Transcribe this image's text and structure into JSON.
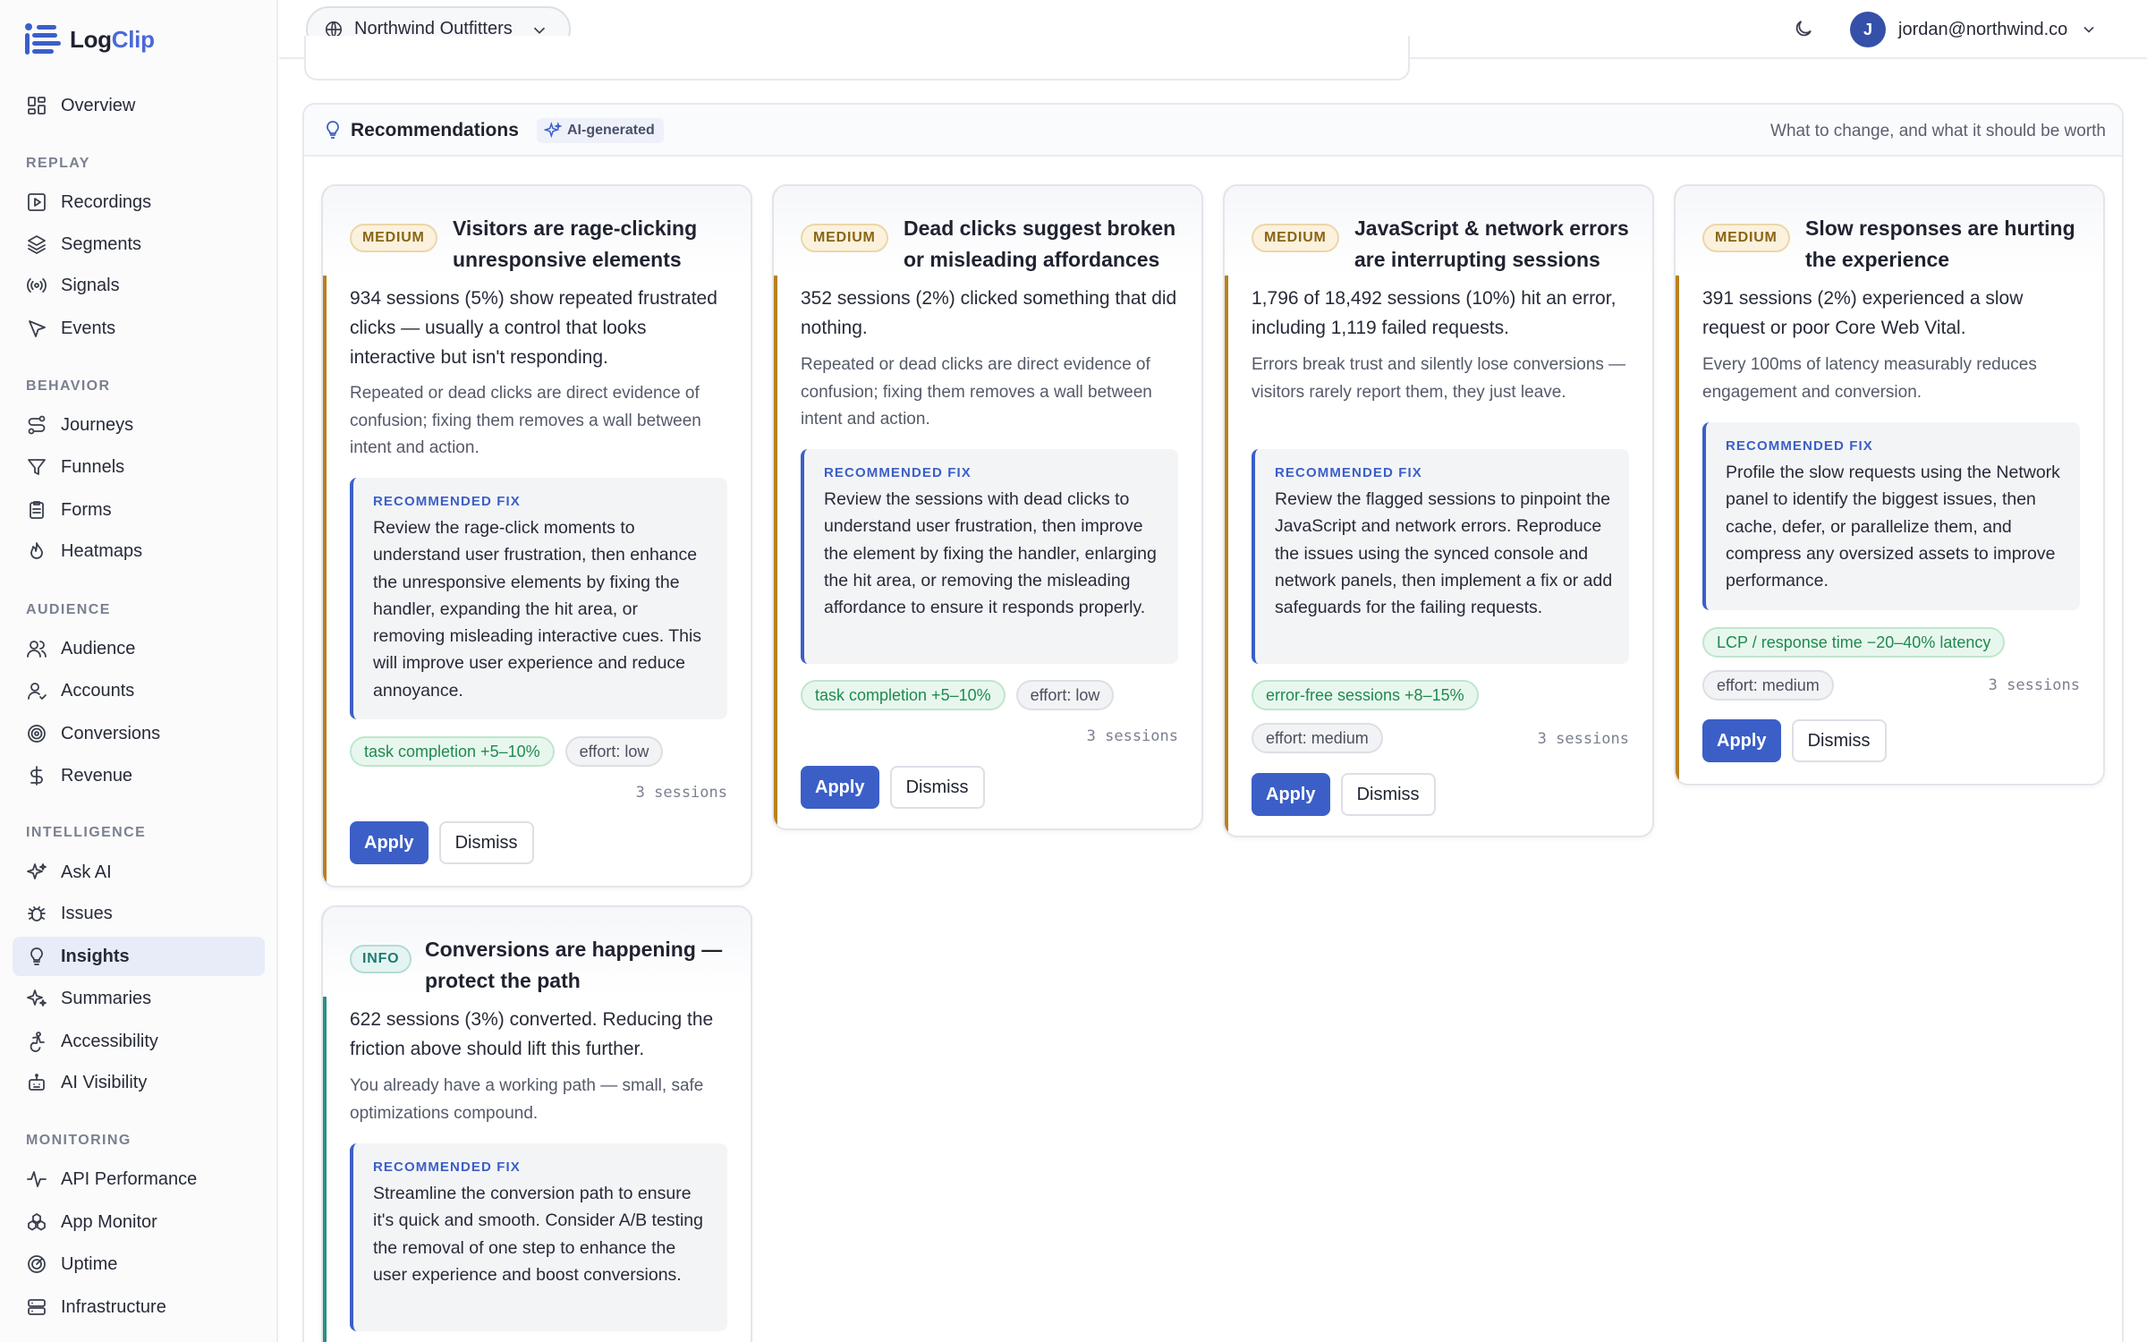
{
  "app": {
    "name_part1": "Log",
    "name_part2": "Clip"
  },
  "topbar": {
    "org_name": "Northwind Outfitters",
    "user_email": "jordan@northwind.co",
    "user_initial": "J"
  },
  "sidebar": {
    "overview": "Overview",
    "sections": {
      "replay": "REPLAY",
      "behavior": "BEHAVIOR",
      "audience": "AUDIENCE",
      "intelligence": "INTELLIGENCE",
      "monitoring": "MONITORING"
    },
    "items": {
      "recordings": "Recordings",
      "segments": "Segments",
      "signals": "Signals",
      "events": "Events",
      "journeys": "Journeys",
      "funnels": "Funnels",
      "forms": "Forms",
      "heatmaps": "Heatmaps",
      "audience": "Audience",
      "accounts": "Accounts",
      "conversions": "Conversions",
      "revenue": "Revenue",
      "ask_ai": "Ask AI",
      "issues": "Issues",
      "insights": "Insights",
      "summaries": "Summaries",
      "accessibility": "Accessibility",
      "ai_visibility": "AI Visibility",
      "api_performance": "API Performance",
      "app_monitor": "App Monitor",
      "uptime": "Uptime",
      "infrastructure": "Infrastructure"
    }
  },
  "recommendations": {
    "title": "Recommendations",
    "ai_badge": "AI-generated",
    "subtitle": "What to change, and what it should be worth",
    "fix_label": "RECOMMENDED FIX",
    "apply_label": "Apply",
    "dismiss_label": "Dismiss",
    "severity_color_medium": "#b9801f",
    "severity_color_info": "#2a8f84",
    "cards": [
      {
        "severity": "MEDIUM",
        "title_line1": "Visitors are rage-clicking",
        "title_line2": "unresponsive elements",
        "summary": "934 sessions (5%) show repeated frustrated clicks — usually a control that looks interactive but isn't responding.",
        "why": "Repeated or dead clicks are direct evidence of confusion; fixing them removes a wall between intent and action.",
        "fix": "Review the rage-click moments to understand user frustration, then enhance the unresponsive elements by fixing the handler, expanding the hit area, or removing misleading interactive cues. This will improve user experience and reduce annoyance.",
        "gain": "task completion +5–10%",
        "effort": "effort: low",
        "sessions": "3 sessions"
      },
      {
        "severity": "MEDIUM",
        "title_line1": "Dead clicks suggest broken",
        "title_line2": "or misleading affordances",
        "summary": "352 sessions (2%) clicked something that did nothing.",
        "why": "Repeated or dead clicks are direct evidence of confusion; fixing them removes a wall between intent and action.",
        "fix": "Review the sessions with dead clicks to understand user frustration, then improve the element by fixing the handler, enlarging the hit area, or removing the misleading affordance to ensure it responds properly.",
        "gain": "task completion +5–10%",
        "effort": "effort: low",
        "sessions": "3 sessions"
      },
      {
        "severity": "MEDIUM",
        "title_line1": "JavaScript & network errors",
        "title_line2": "are interrupting sessions",
        "summary": "1,796 of 18,492 sessions (10%) hit an error, including 1,119 failed requests.",
        "why": "Errors break trust and silently lose conversions — visitors rarely report them, they just leave.",
        "fix": "Review the flagged sessions to pinpoint the JavaScript and network errors. Reproduce the issues using the synced console and network panels, then implement a fix or add safeguards for the failing requests.",
        "gain": "error-free sessions +8–15%",
        "effort": "effort: medium",
        "sessions": "3 sessions"
      },
      {
        "severity": "MEDIUM",
        "title_line1": "Slow responses are hurting",
        "title_line2": "the experience",
        "summary": "391 sessions (2%) experienced a slow request or poor Core Web Vital.",
        "why": "Every 100ms of latency measurably reduces engagement and conversion.",
        "fix": "Profile the slow requests using the Network panel to identify the biggest issues, then cache, defer, or parallelize them, and compress any oversized assets to improve performance.",
        "gain": "LCP / response time −20–40% latency",
        "effort": "effort: medium",
        "sessions": "3 sessions"
      },
      {
        "severity": "INFO",
        "title_line1": "Conversions are happening —",
        "title_line2": "protect the path",
        "summary": "622 sessions (3%) converted. Reducing the friction above should lift this further.",
        "why": "You already have a working path — small, safe optimizations compound.",
        "fix": "Streamline the conversion path to ensure it's quick and smooth. Consider A/B testing the removal of one step to enhance the user experience and boost conversions."
      }
    ]
  }
}
